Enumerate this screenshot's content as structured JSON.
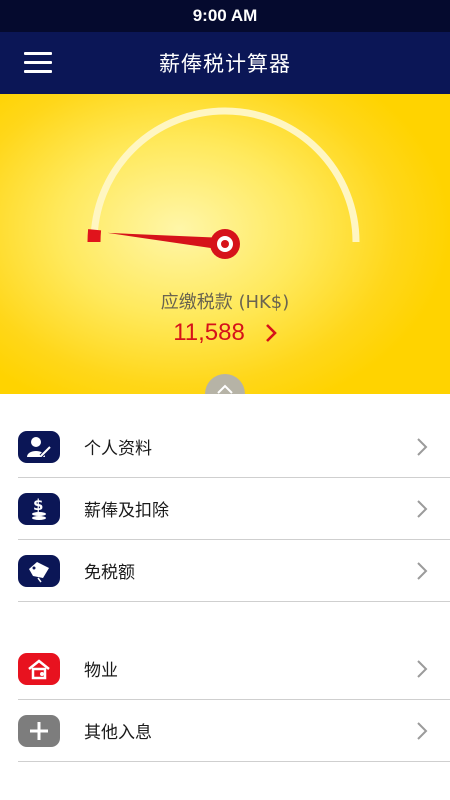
{
  "status_bar": {
    "time": "9:00 AM"
  },
  "nav": {
    "title": "薪俸税计算器"
  },
  "gauge": {
    "level": 0.03
  },
  "summary": {
    "label": "应缴税款 (HK$)",
    "value": "11,588"
  },
  "menu": {
    "items": [
      {
        "label": "个人资料",
        "icon": "person-edit-icon",
        "color": "#0b1656"
      },
      {
        "label": "薪俸及扣除",
        "icon": "dollar-coins-icon",
        "color": "#0b1656"
      },
      {
        "label": "免税额",
        "icon": "tax-tag-icon",
        "color": "#0b1656"
      },
      {
        "label": "物业",
        "icon": "house-icon",
        "color": "#e8121f"
      },
      {
        "label": "其他入息",
        "icon": "plus-icon",
        "color": "#7d7d7d"
      }
    ]
  },
  "colors": {
    "navy": "#0b1656",
    "accent_red": "#d6121a",
    "yellow": "#ffd300"
  }
}
